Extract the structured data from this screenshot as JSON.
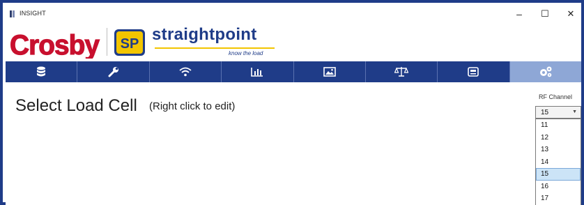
{
  "window": {
    "title": "INSIGHT",
    "minimize": "–",
    "maximize": "☐",
    "close": "✕"
  },
  "brand": {
    "crosby": "Crosby",
    "sp_badge": "SP",
    "straightpoint": "straightpoint",
    "tagline": "know the load",
    "colors": {
      "crosby_red": "#c8102e",
      "sp_blue": "#1f3c88",
      "sp_yellow": "#f2c500"
    }
  },
  "nav": {
    "tabs": [
      {
        "icon": "database-icon"
      },
      {
        "icon": "wrench-icon"
      },
      {
        "icon": "wireless-icon"
      },
      {
        "icon": "bar-chart-icon"
      },
      {
        "icon": "image-icon"
      },
      {
        "icon": "scale-icon"
      },
      {
        "icon": "display-icon"
      },
      {
        "icon": "settings-gears-icon",
        "active": true
      }
    ],
    "colors": {
      "bar": "#1f3c88",
      "active": "#8ea7d6"
    }
  },
  "main": {
    "heading": "Select Load Cell",
    "subheading": "(Right click to edit)"
  },
  "rf_channel": {
    "label": "RF Channel",
    "selected": "15",
    "options": [
      "11",
      "12",
      "13",
      "14",
      "15",
      "16",
      "17"
    ]
  }
}
